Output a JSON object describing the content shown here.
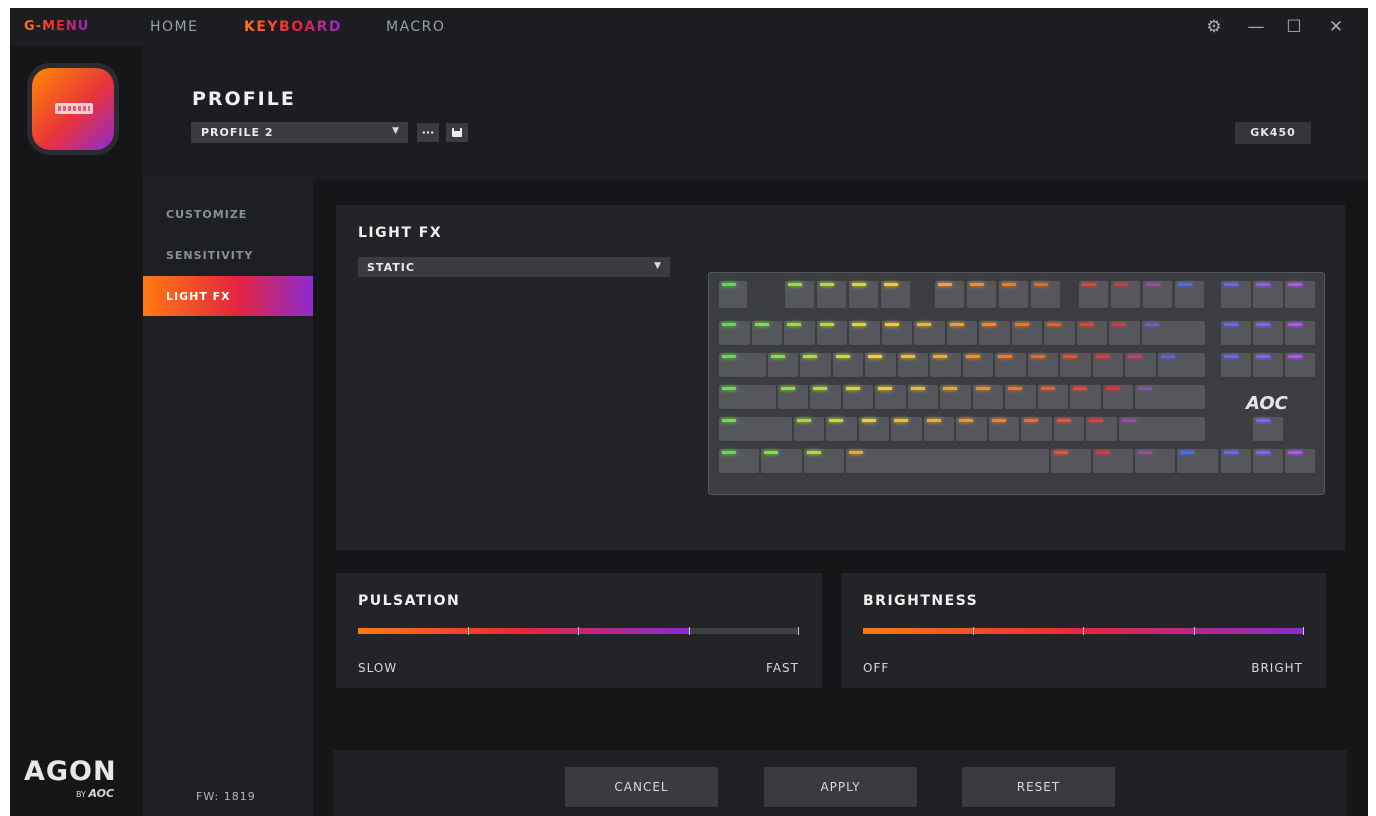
{
  "app": {
    "brand": "G-MENU"
  },
  "nav": {
    "items": [
      "HOME",
      "KEYBOARD",
      "MACRO"
    ],
    "active": "KEYBOARD"
  },
  "window_controls": {
    "settings": "⚙",
    "minimize": "—",
    "maximize": "☐",
    "close": "✕"
  },
  "header": {
    "title": "PROFILE",
    "profile_selected": "PROFILE 2",
    "more_label": "···",
    "model": "GK450"
  },
  "sidebar": {
    "items": [
      {
        "label": "CUSTOMIZE",
        "active": false
      },
      {
        "label": "SENSITIVITY",
        "active": false
      },
      {
        "label": "LIGHT FX",
        "active": true
      }
    ],
    "firmware": "FW: 1819"
  },
  "brand_logo": {
    "name": "AGON",
    "by": "BY",
    "maker": "AOC"
  },
  "lightfx": {
    "title": "LIGHT FX",
    "mode_selected": "STATIC",
    "keyboard_logo": "AOC"
  },
  "pulsation": {
    "title": "PULSATION",
    "min_label": "SLOW",
    "max_label": "FAST",
    "value_fraction": 0.75
  },
  "brightness": {
    "title": "BRIGHTNESS",
    "min_label": "OFF",
    "max_label": "BRIGHT",
    "value_fraction": 1.0
  },
  "footer": {
    "cancel": "CANCEL",
    "apply": "APPLY",
    "reset": "RESET"
  },
  "colors": {
    "accent_orange": "#ff7a10",
    "accent_red": "#e6263e",
    "accent_purple": "#8b2bd1",
    "background": "#151618"
  },
  "icons": [
    "gear-icon",
    "minimize-icon",
    "maximize-icon",
    "close-icon",
    "caret-down-icon",
    "more-icon",
    "save-icon",
    "keyboard-icon"
  ]
}
